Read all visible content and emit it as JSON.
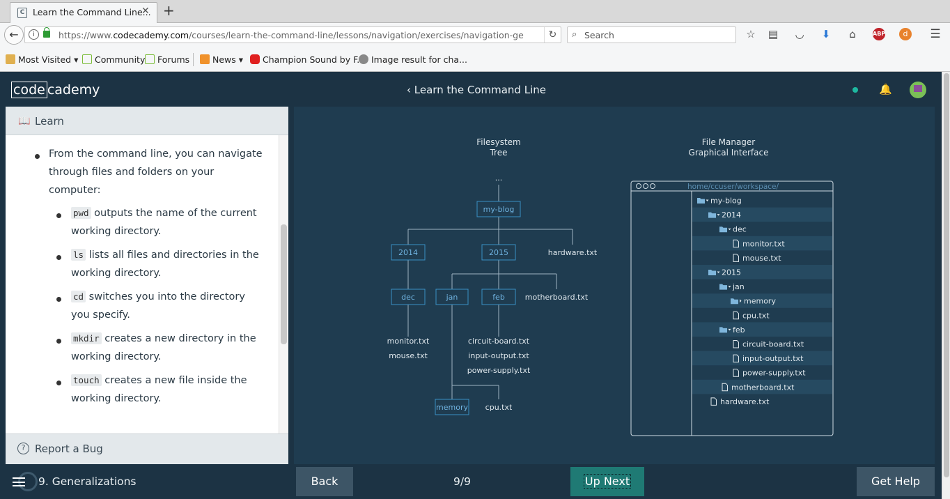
{
  "browser": {
    "tab_title": "Learn the Command Line...",
    "tab_close": "✕",
    "new_tab": "+",
    "url_prefix": "https://www.",
    "url_domain": "codecademy.com",
    "url_path": "/courses/learn-the-command-line/lessons/navigation/exercises/navigation-generalizatior",
    "search_placeholder": "Search",
    "bookmarks": [
      {
        "label": "Most Visited",
        "icon": "star-folder-icon",
        "dropdown": true
      },
      {
        "label": "Community",
        "icon": "codecademy-favicon"
      },
      {
        "label": "Forums",
        "icon": "codecademy-favicon"
      },
      {
        "label": "News",
        "icon": "rss-icon",
        "dropdown": true
      },
      {
        "label": "Champion Sound by F...",
        "icon": "youtube-icon"
      },
      {
        "label": "Image result for cha...",
        "icon": "globe-icon"
      }
    ]
  },
  "app": {
    "logo_left": "code",
    "logo_right": "cademy",
    "course_back_arrow": "‹",
    "course_title": "Learn the Command Line",
    "learn_label": "Learn",
    "lesson": {
      "intro": "From the command line, you can navigate through files and folders on your computer:",
      "items": [
        {
          "code": "pwd",
          "text": " outputs the name of the current working directory."
        },
        {
          "code": "ls",
          "text": " lists all files and directories in the working directory."
        },
        {
          "code": "cd",
          "text": " switches you into the directory you specify."
        },
        {
          "code": "mkdir",
          "text": " creates a new directory in the working directory."
        },
        {
          "code": "touch",
          "text": " creates a new file inside the working directory."
        }
      ]
    },
    "report_bug": "Report a Bug",
    "footer": {
      "lesson": "9. Generalizations",
      "back": "Back",
      "page": "9/9",
      "next": "Up Next",
      "help": "Get Help"
    }
  },
  "diagram": {
    "tree_title_1": "Filesystem",
    "tree_title_2": "Tree",
    "tree_ellipsis": "...",
    "tree_nodes": {
      "root": "my-blog",
      "y2014": "2014",
      "y2015": "2015",
      "hardware": "hardware.txt",
      "dec": "dec",
      "jan": "jan",
      "feb": "feb",
      "motherboard": "motherboard.txt",
      "monitor": "monitor.txt",
      "mouse": "mouse.txt",
      "circuit": "circuit-board.txt",
      "input": "input-output.txt",
      "power": "power-supply.txt",
      "memory": "memory",
      "cpu": "cpu.txt"
    },
    "fm_title_1": "File Manager",
    "fm_title_2": "Graphical Interface",
    "fm_path": "home/ccuser/workspace/",
    "fm_rows": [
      {
        "label": "my-blog",
        "type": "folder",
        "level": 0,
        "expanded": true
      },
      {
        "label": "2014",
        "type": "folder",
        "level": 1,
        "expanded": true
      },
      {
        "label": "dec",
        "type": "folder",
        "level": 2,
        "expanded": true
      },
      {
        "label": "monitor.txt",
        "type": "file",
        "level": 3
      },
      {
        "label": "mouse.txt",
        "type": "file",
        "level": 3
      },
      {
        "label": "2015",
        "type": "folder",
        "level": 1,
        "expanded": true
      },
      {
        "label": "jan",
        "type": "folder",
        "level": 2,
        "expanded": true
      },
      {
        "label": "memory",
        "type": "folder",
        "level": 3,
        "expanded": false
      },
      {
        "label": "cpu.txt",
        "type": "file",
        "level": 3
      },
      {
        "label": "feb",
        "type": "folder",
        "level": 2,
        "expanded": true
      },
      {
        "label": "circuit-board.txt",
        "type": "file",
        "level": 3
      },
      {
        "label": "input-output.txt",
        "type": "file",
        "level": 3
      },
      {
        "label": "power-supply.txt",
        "type": "file",
        "level": 3
      },
      {
        "label": "motherboard.txt",
        "type": "file",
        "level": 2
      },
      {
        "label": "hardware.txt",
        "type": "file",
        "level": 1
      }
    ]
  },
  "colors": {
    "accent": "#1eb8a0",
    "diagram_line": "#9fb3c2",
    "diagram_box": "#3a8fc4",
    "next_button": "#1f7a74"
  }
}
